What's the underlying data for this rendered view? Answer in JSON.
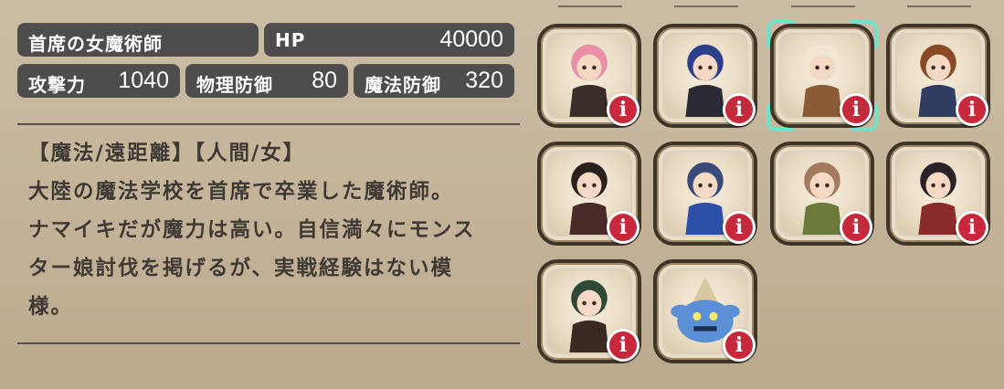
{
  "stats": {
    "name": "首席の女魔術師",
    "hp_label": "HP",
    "hp_value": "40000",
    "atk_label": "攻撃力",
    "atk_value": "1040",
    "pdef_label": "物理防御",
    "pdef_value": "80",
    "mdef_label": "魔法防御",
    "mdef_value": "320"
  },
  "description": {
    "tags": "【魔法/遠距離】【人間/女】",
    "lines": [
      "大陸の魔法学校を首席で卒業した魔術師。",
      "ナマイキだが魔力は高い。自信満々にモンス",
      "ター娘討伐を掲げるが、実戦経験はない模",
      "様。"
    ]
  },
  "roster": {
    "info_symbol": "i",
    "selected_index": 2,
    "units": [
      {
        "icon": "pink-haired-witch-portrait",
        "hair": "#e98fa6",
        "outfit": "#3a2e2a"
      },
      {
        "icon": "blue-haired-swordswoman-portrait",
        "hair": "#2c3f8a",
        "outfit": "#2b2b35"
      },
      {
        "icon": "blonde-girl-with-bow-portrait",
        "hair": "#f1e6cf",
        "outfit": "#8b5a36"
      },
      {
        "icon": "brown-haired-swordsman-portrait",
        "hair": "#8a4a26",
        "outfit": "#2f3d63"
      },
      {
        "icon": "faceless-villager-portrait",
        "hair": "#2a211d",
        "outfit": "#4a2a28"
      },
      {
        "icon": "blue-witch-hat-mage-portrait",
        "hair": "#3a4a7a",
        "outfit": "#2d4fa8"
      },
      {
        "icon": "pink-ribbon-shield-girl-portrait",
        "hair": "#a47a5e",
        "outfit": "#6b7a3a"
      },
      {
        "icon": "dark-haired-lancer-girl-portrait",
        "hair": "#2a2326",
        "outfit": "#8a2a2a"
      },
      {
        "icon": "green-haired-bandit-girl-portrait",
        "hair": "#2e4a36",
        "outfit": "#3a2a24"
      },
      {
        "icon": "blue-crab-monster-portrait",
        "hair": "#d9c9a0",
        "outfit": "#5b8fd6"
      }
    ]
  }
}
